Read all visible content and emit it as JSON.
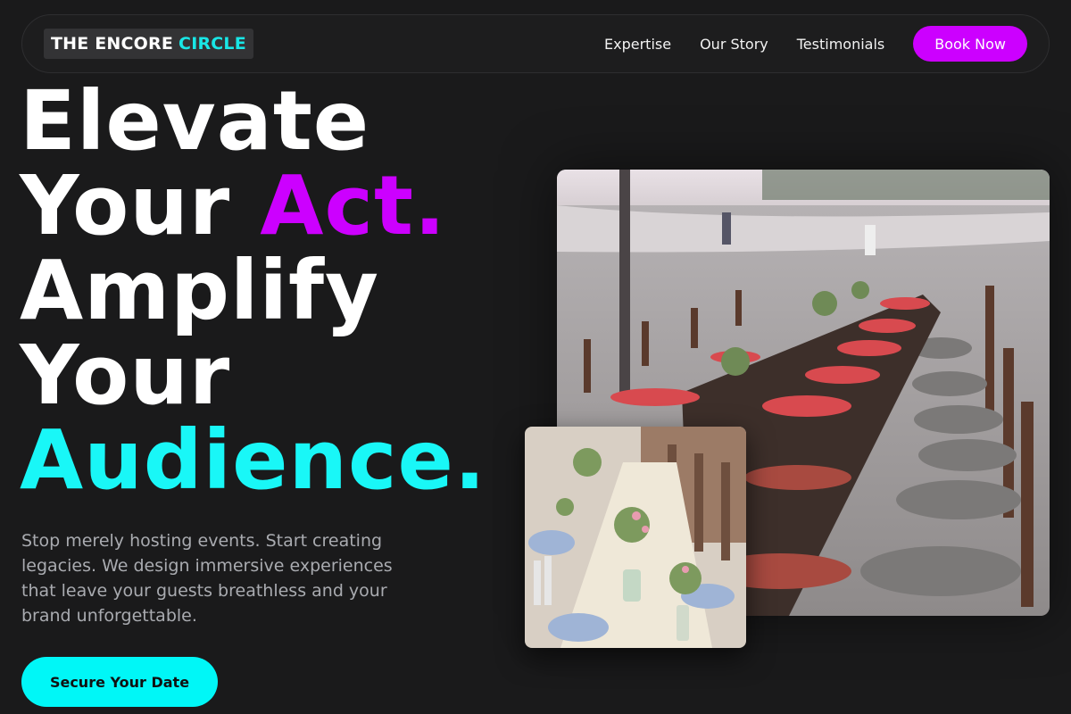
{
  "nav": {
    "logo_main": "THE ENCORE",
    "logo_accent": "CIRCLE",
    "links": [
      "Expertise",
      "Our Story",
      "Testimonials"
    ],
    "book_label": "Book Now"
  },
  "hero": {
    "line1": "Elevate",
    "line2_a": "Your",
    "line2_b": "Act.",
    "line3": "Amplify",
    "line4": "Your",
    "line5": "Audience.",
    "subtitle": "Stop merely hosting events. Start creating legacies. We design immersive experiences that leave your guests breathless and your brand unforgettable.",
    "cta_label": "Secure Your Date"
  },
  "colors": {
    "background": "#1a1a1b",
    "magenta": "#cc00ff",
    "cyan": "#19f7f7"
  },
  "images": {
    "main": "beach-banquet-table-photo",
    "small": "floral-table-setting-photo"
  }
}
